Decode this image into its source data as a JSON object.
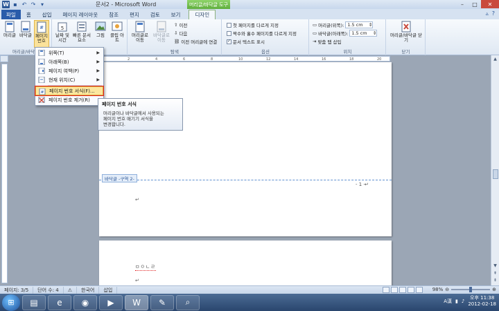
{
  "window": {
    "title": "문서2 - Microsoft Word",
    "context_tab_title": "머리글/바닥글 도구"
  },
  "tabs": [
    {
      "label": "파일"
    },
    {
      "label": "홈"
    },
    {
      "label": "삽입"
    },
    {
      "label": "페이지 레이아웃"
    },
    {
      "label": "참조"
    },
    {
      "label": "편지"
    },
    {
      "label": "검토"
    },
    {
      "label": "보기"
    },
    {
      "label": "디자인"
    }
  ],
  "ribbon": {
    "header_footer_group": {
      "label": "머리글/바닥글",
      "header_btn": "머리글",
      "footer_btn": "바닥글",
      "page_number_btn": "페이지 번호"
    },
    "insert_group": {
      "label": "삽입",
      "datetime_btn": "날짜 및 시간",
      "quickparts_btn": "빠른 문서 요소",
      "picture_btn": "그림",
      "clipart_btn": "클립 아트"
    },
    "navigation_group": {
      "label": "탐색",
      "goto_header_btn": "머리글로 이동",
      "goto_footer_btn": "바닥글로 이동",
      "previous": "이전",
      "next": "다음",
      "link_previous": "이전 머리글에 연결"
    },
    "options_group": {
      "label": "옵션",
      "different_first": "첫 페이지를 다르게 지정",
      "different_odd_even": "짝수와 홀수 페이지를 다르게 지정",
      "show_doc_text": "문서 텍스트 표시"
    },
    "position_group": {
      "label": "위치",
      "header_from_top_label": "머리글(위쪽):",
      "header_from_top_value": "1.5 cm",
      "footer_from_bottom_label": "바닥글(아래쪽):",
      "footer_from_bottom_value": "1.5 cm",
      "insert_align_tab": "맞춤 탭 삽입"
    },
    "close_group": {
      "label": "닫기",
      "close_btn": "머리글/바닥글 닫기"
    }
  },
  "menu": {
    "items": [
      {
        "label": "위쪽(T)"
      },
      {
        "label": "아래쪽(B)"
      },
      {
        "label": "페이지 여백(P)"
      },
      {
        "label": "현재 위치(C)"
      },
      {
        "label": "페이지 번호 서식(F)..."
      },
      {
        "label": "페이지 번호 제거(R)"
      }
    ]
  },
  "tooltip": {
    "title": "페이지 번호 서식",
    "body_line1": "머리글이나 바닥글에서 사용되는",
    "body_line2": "페이지 번호 매기기 서식을",
    "body_line3": "변경합니다."
  },
  "document": {
    "footer_tag": "바닥글 -구역 2-",
    "page_number": "- 1 -",
    "para_mark": "↵",
    "text_line": "ㅁㅇㄴㄹ"
  },
  "status": {
    "page": "페이지: 3/5",
    "words": "단어 수: 4",
    "language": "한국어",
    "insert_mode": "삽입",
    "zoom": "98%"
  },
  "taskbar": {
    "time": "오후 11:38",
    "date": "2012-02-18",
    "ime": "A漢"
  },
  "colors": {
    "accent": "#2a5caa",
    "context_green": "#5fae3c",
    "highlight": "#fce79e",
    "red_box": "#e02020"
  }
}
